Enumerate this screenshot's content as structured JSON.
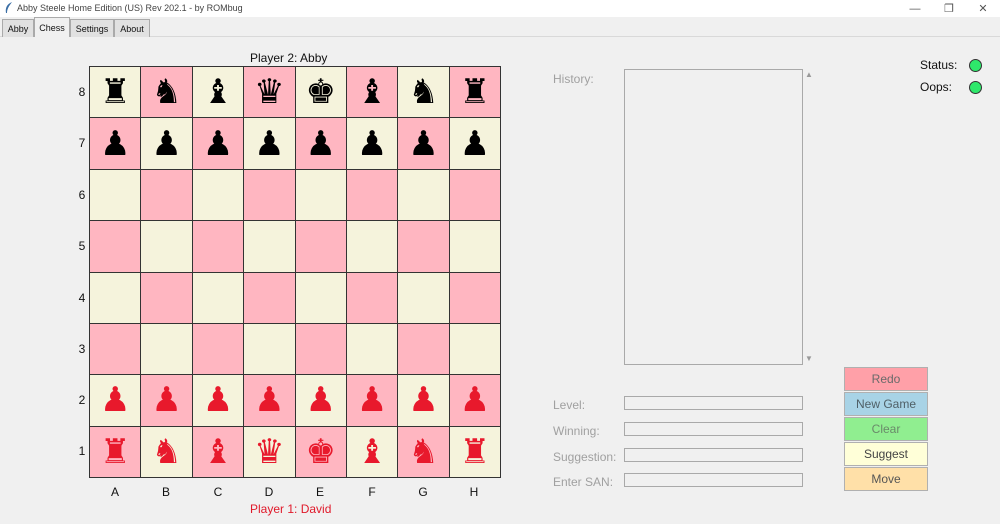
{
  "window": {
    "title": "Abby Steele Home Edition (US) Rev 202.1 - by ROMbug",
    "minimize_symbol": "—",
    "maximize_symbol": "❐",
    "close_symbol": "✕"
  },
  "tabs": [
    {
      "label": "Abby"
    },
    {
      "label": "Chess"
    },
    {
      "label": "Settings"
    },
    {
      "label": "About"
    }
  ],
  "players": {
    "top": "Player 2: Abby",
    "bottom": "Player 1: David"
  },
  "board": {
    "ranks": [
      "8",
      "7",
      "6",
      "5",
      "4",
      "3",
      "2",
      "1"
    ],
    "files": [
      "A",
      "B",
      "C",
      "D",
      "E",
      "F",
      "G",
      "H"
    ],
    "light_color": "#f5f3dc",
    "dark_color": "#ffb6c1",
    "black_piece_color": "#000000",
    "red_piece_color": "#e8192c",
    "rows": [
      [
        "♜",
        "♞",
        "♝",
        "♛",
        "♚",
        "♝",
        "♞",
        "♜"
      ],
      [
        "♟",
        "♟",
        "♟",
        "♟",
        "♟",
        "♟",
        "♟",
        "♟"
      ],
      [
        "",
        "",
        "",
        "",
        "",
        "",
        "",
        ""
      ],
      [
        "",
        "",
        "",
        "",
        "",
        "",
        "",
        ""
      ],
      [
        "",
        "",
        "",
        "",
        "",
        "",
        "",
        ""
      ],
      [
        "",
        "",
        "",
        "",
        "",
        "",
        "",
        ""
      ],
      [
        "♟",
        "♟",
        "♟",
        "♟",
        "♟",
        "♟",
        "♟",
        "♟"
      ],
      [
        "♜",
        "♞",
        "♝",
        "♛",
        "♚",
        "♝",
        "♞",
        "♜"
      ]
    ]
  },
  "panel": {
    "history_label": "History:",
    "level_label": "Level:",
    "winning_label": "Winning:",
    "suggestion_label": "Suggestion:",
    "enter_san_label": "Enter SAN:",
    "level_value": "",
    "winning_value": "",
    "suggestion_value": "",
    "san_value": ""
  },
  "buttons": {
    "redo": "Redo",
    "new_game": "New Game",
    "clear": "Clear",
    "suggest": "Suggest",
    "move": "Move"
  },
  "status": {
    "status_label": "Status:",
    "oops_label": "Oops:",
    "status_color": "#2ee86b",
    "oops_color": "#2ee86b"
  },
  "icons": {
    "app": "feather-icon",
    "scroll_up": "▲",
    "scroll_down": "▼"
  }
}
